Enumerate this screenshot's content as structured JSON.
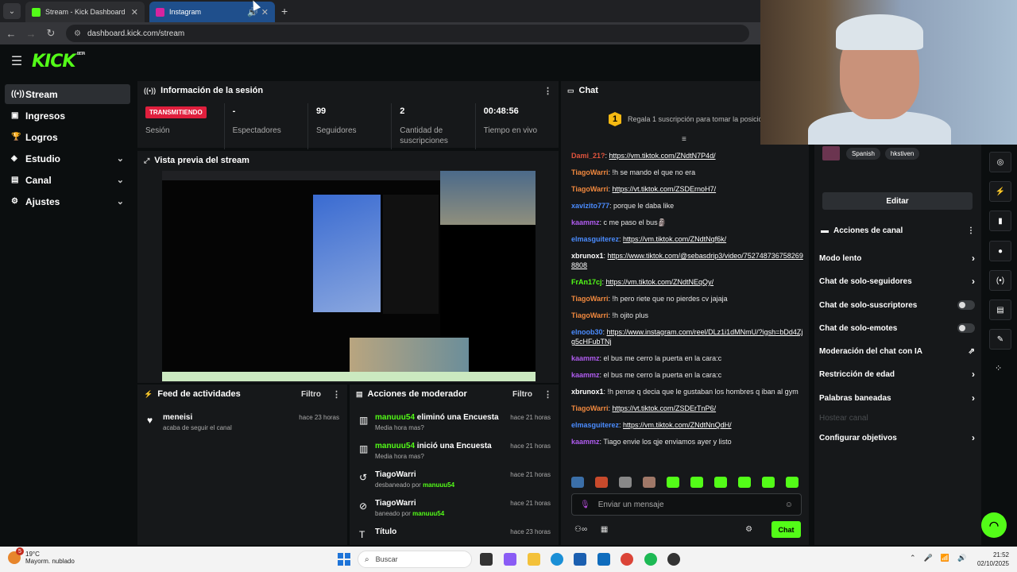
{
  "browser": {
    "tabs": [
      {
        "title": "Stream - Kick Dashboard",
        "active": false
      },
      {
        "title": "Instagram",
        "active": true
      }
    ],
    "url": "dashboard.kick.com/stream"
  },
  "brand": {
    "logo": "KICK",
    "badge": "BETA",
    "accent": "#53fc18"
  },
  "sidebar": {
    "items": [
      {
        "label": "Stream",
        "icon": "broadcast-icon",
        "active": true
      },
      {
        "label": "Ingresos",
        "icon": "cash-icon"
      },
      {
        "label": "Logros",
        "icon": "trophy-icon"
      },
      {
        "label": "Estudio",
        "icon": "layers-icon",
        "expandable": true
      },
      {
        "label": "Canal",
        "icon": "channel-icon",
        "expandable": true
      },
      {
        "label": "Ajustes",
        "icon": "gear-icon",
        "expandable": true
      }
    ]
  },
  "session": {
    "title": "Información de la sesión",
    "live_label": "TRANSMITIENDO",
    "status_label": "Sesión",
    "stats": [
      {
        "value": "-",
        "label": "Espectadores"
      },
      {
        "value": "99",
        "label": "Seguidores"
      },
      {
        "value": "2",
        "label": "Cantidad de suscripciones"
      },
      {
        "value": "00:48:56",
        "label": "Tiempo en vivo"
      }
    ]
  },
  "preview": {
    "title": "Vista previa del stream"
  },
  "feed": {
    "title": "Feed de actividades",
    "filter": "Filtro",
    "items": [
      {
        "user": "meneisi",
        "text": "acaba de seguir el canal",
        "time": "hace 23 horas"
      }
    ]
  },
  "modactions": {
    "title": "Acciones de moderador",
    "filter": "Filtro",
    "items": [
      {
        "user": "manuuu54",
        "action": " eliminó una Encuesta",
        "sub": "Media hora mas?",
        "time": "hace 21 horas",
        "icon": "poll-icon"
      },
      {
        "user": "manuuu54",
        "action": " inició una Encuesta",
        "sub": "Media hora mas?",
        "time": "hace 21 horas",
        "icon": "poll-icon"
      },
      {
        "user": "TiagoWarri",
        "action": "",
        "sub_pre": "desbaneado por ",
        "sub_user": "manuuu54",
        "time": "hace 21 horas",
        "icon": "undo-icon"
      },
      {
        "user": "TiagoWarri",
        "action": "",
        "sub_pre": "baneado por ",
        "sub_user": "manuuu54",
        "time": "hace 21 horas",
        "icon": "ban-icon"
      },
      {
        "user": "Título",
        "action": "",
        "sub": "",
        "time": "hace 23 horas",
        "icon": "title-icon"
      }
    ]
  },
  "chat": {
    "title": "Chat",
    "pinned": {
      "badge": "1",
      "text": "Regala 1 suscripción para tomar la posición"
    },
    "messages": [
      {
        "user": "Dami_21?",
        "color": "#e0533d",
        "link": "https://vm.tiktok.com/ZNdtN7P4d/",
        "text": ""
      },
      {
        "user": "TiagoWarri",
        "color": "#f0883e",
        "text": "!h se mando el que no era"
      },
      {
        "user": "TiagoWarri",
        "color": "#f0883e",
        "link": "https://vt.tiktok.com/ZSDErnoH7/",
        "text": ""
      },
      {
        "user": "xavizito777",
        "color": "#4a8cff",
        "text": "porque le daba like"
      },
      {
        "user": "kaammz",
        "color": "#b05cf0",
        "text": "c me paso el bus🗿"
      },
      {
        "user": "elmasguiterez",
        "color": "#4a8cff",
        "link": "https://vm.tiktok.com/ZNdtNqf6k/",
        "text": ""
      },
      {
        "user": "xbrunox1",
        "color": "#ffffff",
        "link": "https://www.tiktok.com/@sebasdrip3/video/7527487367582698808",
        "text": ""
      },
      {
        "user": "FrAn17cj",
        "color": "#53fc18",
        "link": "https://vm.tiktok.com/ZNdtNEqQy/",
        "text": ""
      },
      {
        "user": "TiagoWarri",
        "color": "#f0883e",
        "text": "!h pero riete que no pierdes cv jajaja"
      },
      {
        "user": "TiagoWarri",
        "color": "#f0883e",
        "text": "!h ojito plus"
      },
      {
        "user": "elnoob30",
        "color": "#4a8cff",
        "link": "https://www.instagram.com/reel/DLz1i1dMNmU/?igsh=bDd4Zjg5cHFubTNj",
        "text": ""
      },
      {
        "user": "kaammz",
        "color": "#b05cf0",
        "text": "el bus me cerro la puerta en la cara:c"
      },
      {
        "user": "kaammz",
        "color": "#b05cf0",
        "text": "el bus me cerro la puerta en la cara:c"
      },
      {
        "user": "xbrunox1",
        "color": "#ffffff",
        "text": "!h pense q decia que le gustaban los hombres q iban al gym"
      },
      {
        "user": "TiagoWarri",
        "color": "#f0883e",
        "link": "https://vt.tiktok.com/ZSDErTnP6/",
        "text": ""
      },
      {
        "user": "elmasguiterez",
        "color": "#4a8cff",
        "link": "https://vm.tiktok.com/ZNdtNnQdH/",
        "text": ""
      },
      {
        "user": "kaammz",
        "color": "#b05cf0",
        "text": "Tiago envie los qje enviamos ayer y listo"
      }
    ],
    "input_placeholder": "Enviar un mensaje",
    "send_label": "Chat"
  },
  "channel_panel": {
    "tags": [
      "Spanish",
      "hkstiven"
    ],
    "edit_label": "Editar",
    "actions_title": "Acciones de canal",
    "actions": [
      {
        "label": "Modo lento",
        "control": "chevron"
      },
      {
        "label": "Chat de solo-seguidores",
        "control": "chevron"
      },
      {
        "label": "Chat de solo-suscriptores",
        "control": "toggle"
      },
      {
        "label": "Chat de solo-emotes",
        "control": "toggle"
      },
      {
        "label": "Moderación del chat con IA",
        "control": "external"
      },
      {
        "label": "Restricción de edad",
        "control": "chevron"
      },
      {
        "label": "Palabras baneadas",
        "control": "chevron"
      },
      {
        "label": "Hostear canal",
        "control": "disabled"
      },
      {
        "label": "Configurar objetivos",
        "control": "chevron"
      }
    ]
  },
  "taskbar": {
    "weather_temp": "19°C",
    "weather_desc": "Mayorm. nublado",
    "weather_badge": "5",
    "search_placeholder": "Buscar",
    "time": "21:52",
    "date": "02/10/2025"
  }
}
